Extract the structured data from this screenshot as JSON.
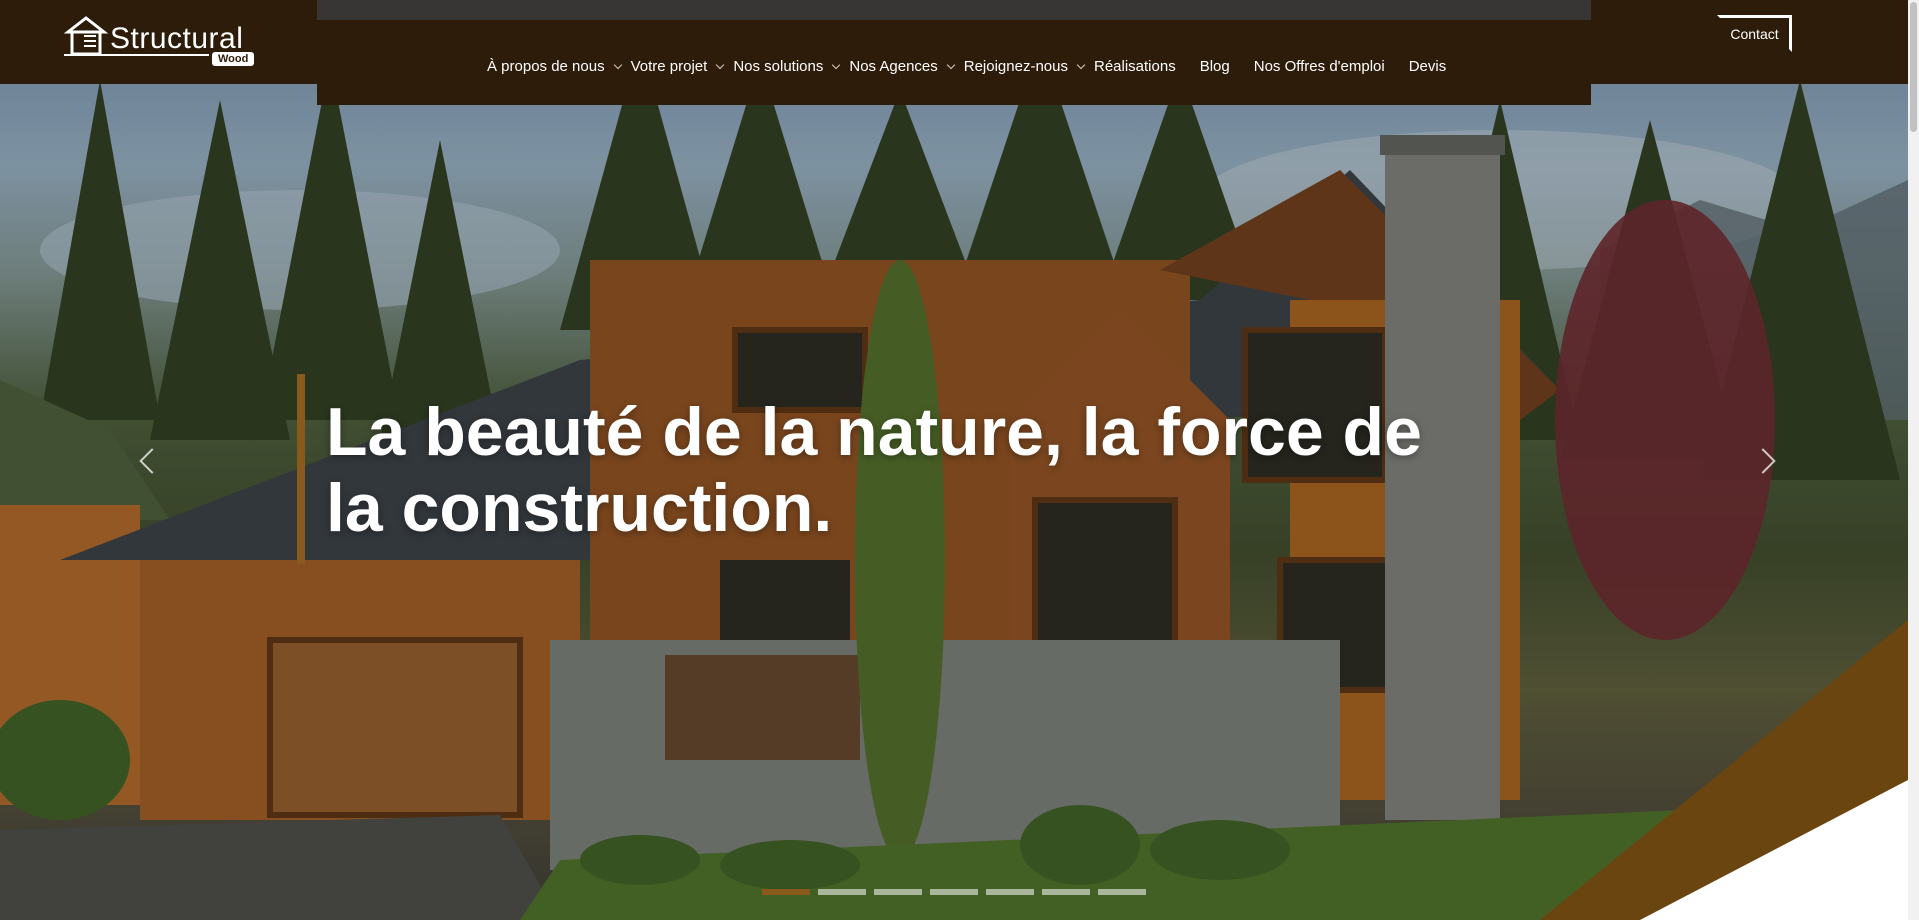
{
  "logo": {
    "name": "Structural",
    "sub": "Wood"
  },
  "nav": {
    "items": [
      {
        "label": "À propos de nous",
        "has_submenu": true
      },
      {
        "label": "Votre projet",
        "has_submenu": true
      },
      {
        "label": "Nos solutions",
        "has_submenu": true
      },
      {
        "label": "Nos Agences",
        "has_submenu": true
      },
      {
        "label": "Rejoignez-nous",
        "has_submenu": true
      },
      {
        "label": "Réalisations",
        "has_submenu": false
      },
      {
        "label": "Blog",
        "has_submenu": false
      },
      {
        "label": "Nos Offres d'emploi",
        "has_submenu": false
      },
      {
        "label": "Devis",
        "has_submenu": false
      }
    ],
    "contact_label": "Contact"
  },
  "hero": {
    "headline": "La beauté de la nature, la force de la construction.",
    "slide_count": 7,
    "active_slide": 1
  },
  "colors": {
    "brand_dark": "#2e1c0a",
    "accent": "#8a5a1c",
    "white": "#ffffff"
  }
}
